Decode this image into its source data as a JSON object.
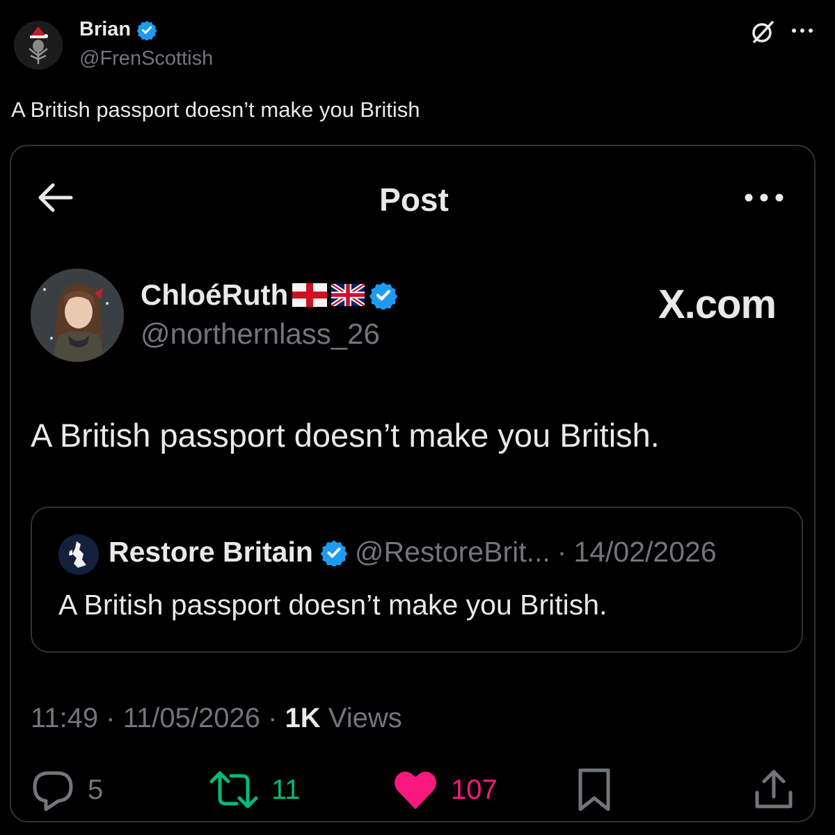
{
  "outer_post": {
    "author_name": "Brian",
    "author_handle": "@FrenScottish",
    "text": "A British passport doesn’t make you British"
  },
  "screenshot_post": {
    "header_title": "Post",
    "author_name": "ChloéRuth",
    "author_handle": "@northernlass_26",
    "watermark": "X.com",
    "text": "A British passport doesn’t make you British.",
    "quoted": {
      "author_name": "Restore Britain",
      "author_handle": "@RestoreBrit...",
      "separator": "·",
      "date": "14/02/2026",
      "text": "A British passport doesn’t make you British."
    },
    "meta": {
      "time": "11:49",
      "date": "11/05/2026",
      "views_count": "1K",
      "views_label": "Views",
      "separator": "·"
    },
    "actions": {
      "replies": "5",
      "reposts": "11",
      "likes": "107"
    }
  },
  "icons": {
    "verified": "verified-badge-icon",
    "grok": "grok-icon",
    "more": "more-dots-icon",
    "back": "back-arrow-icon",
    "reply": "reply-icon",
    "repost": "repost-icon",
    "like": "heart-icon",
    "bookmark": "bookmark-icon",
    "share": "share-icon"
  },
  "colors": {
    "background": "#000000",
    "verified": "#1d9bf0",
    "repost": "#00ba7c",
    "like": "#f91880",
    "muted": "#71767b"
  }
}
